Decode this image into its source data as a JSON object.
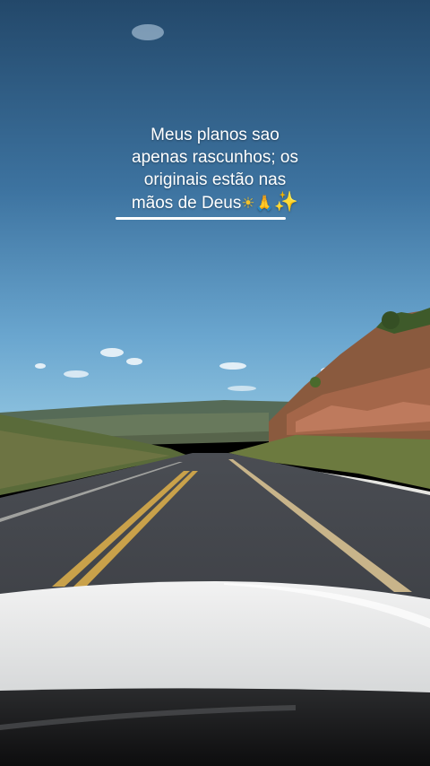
{
  "caption": {
    "line1": "Meus planos sao",
    "line2": "apenas rascunhos; os",
    "line3": "originais estão nas",
    "line4": "mãos de Deus",
    "emoji_sun": "☀",
    "emoji_hands": "🙏",
    "emoji_sparkles": "✨"
  },
  "colors": {
    "sky_top": "#2c5577",
    "sky_bottom": "#7fb7d8",
    "road": "#3b3e44",
    "lane_yellow": "#c9a14a",
    "hood": "#e9eaea"
  }
}
